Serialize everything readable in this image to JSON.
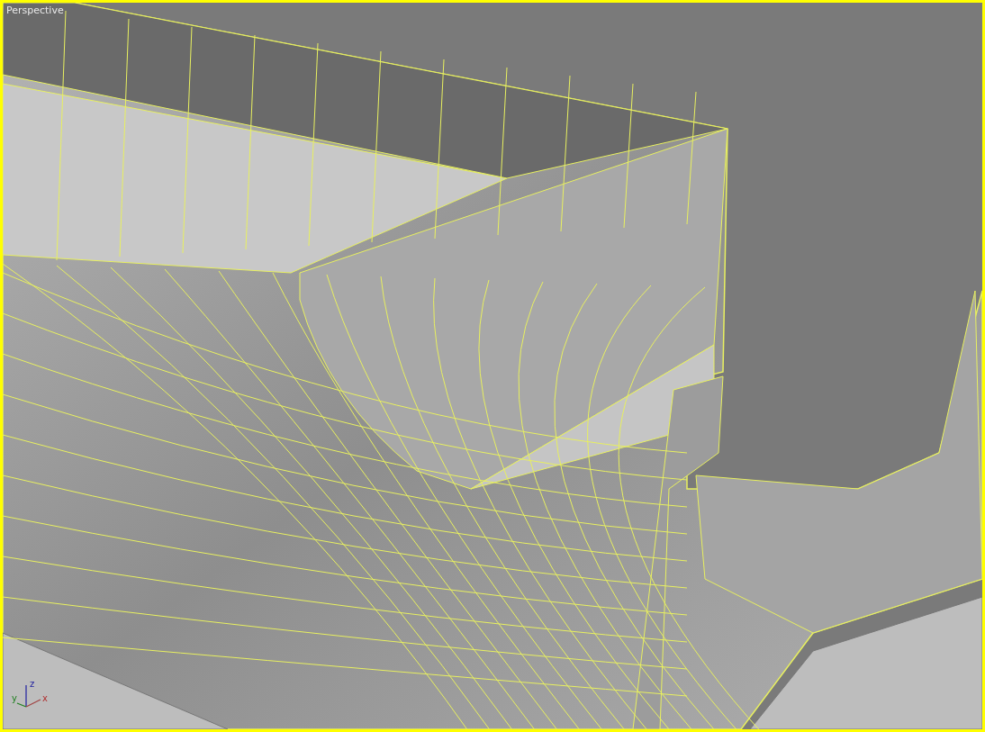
{
  "viewport": {
    "label": "Perspective",
    "active": true
  },
  "axis_gizmo": {
    "x_label": "x",
    "y_label": "y",
    "z_label": "z"
  }
}
